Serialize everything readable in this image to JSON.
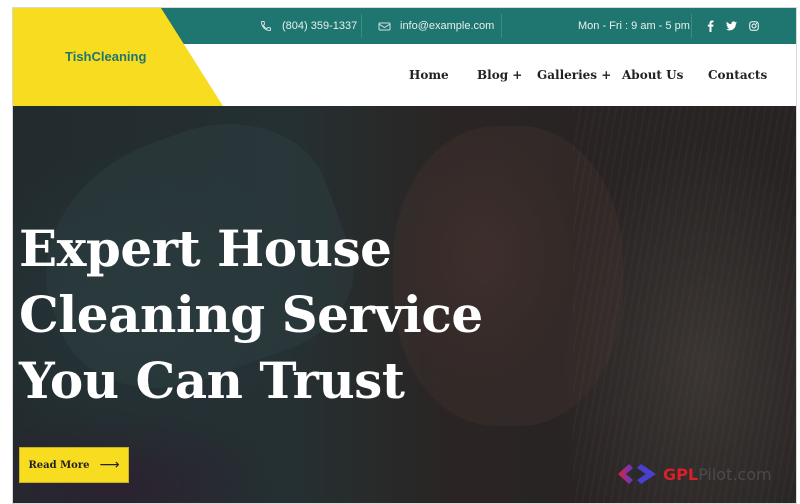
{
  "brand": {
    "name": "TishCleaning",
    "colors": {
      "primary": "#1f7570",
      "accent": "#f8dc20",
      "text_dark": "#222222"
    }
  },
  "topbar": {
    "phone": {
      "icon": "phone-icon",
      "text": "(804) 359-1337"
    },
    "email": {
      "icon": "mail-icon",
      "text": "info@example.com"
    },
    "hours": "Mon - Fri : 9 am - 5 pm",
    "social": [
      {
        "name": "facebook-icon",
        "glyph": "f"
      },
      {
        "name": "twitter-icon",
        "glyph": "🐦"
      },
      {
        "name": "instagram-icon",
        "glyph": "◎"
      }
    ]
  },
  "nav": {
    "items": [
      {
        "label": "Home"
      },
      {
        "label": "Blog +"
      },
      {
        "label": "Galleries +"
      },
      {
        "label": "About Us"
      },
      {
        "label": "Contacts"
      }
    ]
  },
  "hero": {
    "headline": [
      "Expert House",
      "Cleaning Service",
      "You Can Trust"
    ],
    "button": {
      "label": "Read More",
      "arrow": "⟶"
    }
  },
  "watermark": {
    "part1": "GPL",
    "part2": "Pilot.com"
  }
}
